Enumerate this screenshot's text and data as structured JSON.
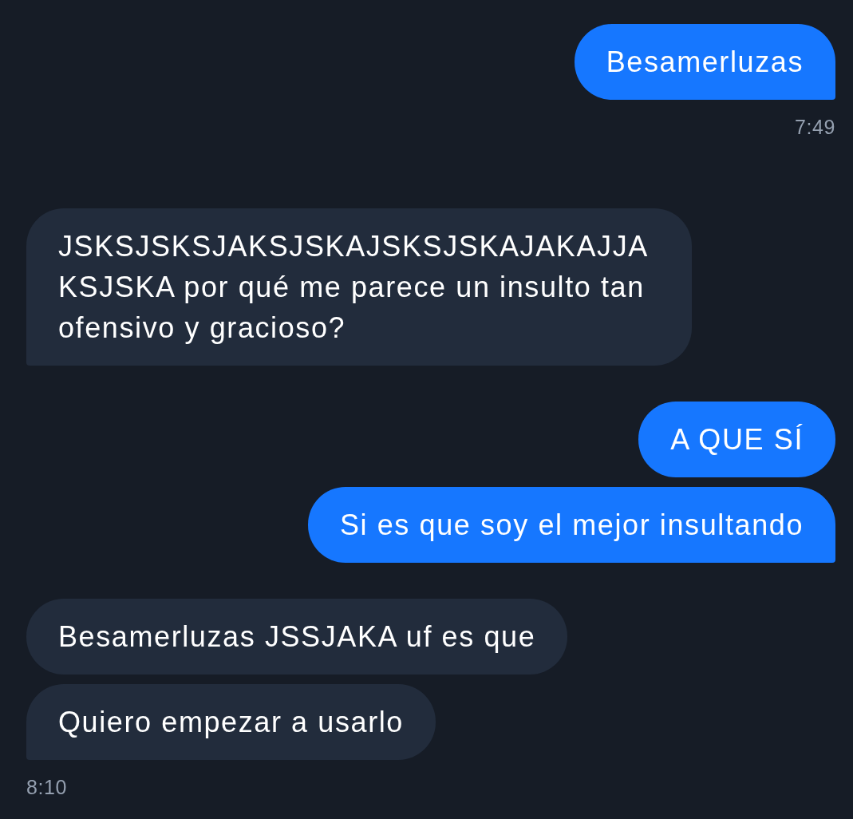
{
  "conversation": [
    {
      "kind": "outgoing",
      "messages": [
        "Besamerluzas"
      ],
      "time": "7:49"
    },
    {
      "kind": "incoming",
      "messages": [
        "JSKSJSKSJAKSJSKAJSKSJSKAJAKAJJAKSJSKA por qué me parece un insulto tan ofensivo y gracioso?"
      ]
    },
    {
      "kind": "outgoing",
      "messages": [
        "A QUE SÍ",
        "Si es que soy el mejor insultando"
      ]
    },
    {
      "kind": "incoming",
      "messages": [
        "Besamerluzas JSSJAKA uf es que",
        "Quiero empezar a usarlo"
      ],
      "time": "8:10"
    }
  ]
}
